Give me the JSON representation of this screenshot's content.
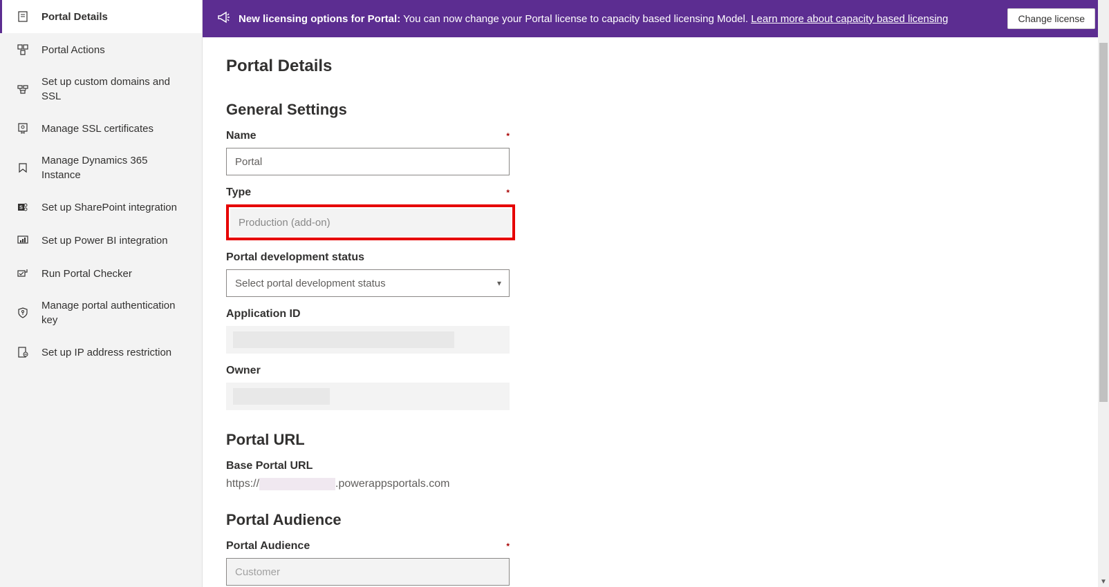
{
  "sidebar": {
    "items": [
      {
        "label": "Portal Details",
        "active": true,
        "icon": "document-icon"
      },
      {
        "label": "Portal Actions",
        "active": false,
        "icon": "actions-icon"
      },
      {
        "label": "Set up custom domains and SSL",
        "active": false,
        "icon": "domains-icon"
      },
      {
        "label": "Manage SSL certificates",
        "active": false,
        "icon": "certificate-icon"
      },
      {
        "label": "Manage Dynamics 365 Instance",
        "active": false,
        "icon": "dynamics-icon"
      },
      {
        "label": "Set up SharePoint integration",
        "active": false,
        "icon": "sharepoint-icon"
      },
      {
        "label": "Set up Power BI integration",
        "active": false,
        "icon": "powerbi-icon"
      },
      {
        "label": "Run Portal Checker",
        "active": false,
        "icon": "checker-icon"
      },
      {
        "label": "Manage portal authentication key",
        "active": false,
        "icon": "key-icon"
      },
      {
        "label": "Set up IP address restriction",
        "active": false,
        "icon": "ip-icon"
      }
    ]
  },
  "banner": {
    "title": "New licensing options for Portal:",
    "text": "You can now change your Portal license to capacity based licensing Model.",
    "link": "Learn more about capacity based licensing",
    "button": "Change license"
  },
  "page": {
    "title": "Portal Details",
    "general_title": "General Settings",
    "name_label": "Name",
    "name_value": "Portal",
    "type_label": "Type",
    "type_value": "Production (add-on)",
    "status_label": "Portal development status",
    "status_placeholder": "Select portal development status",
    "appid_label": "Application ID",
    "owner_label": "Owner",
    "url_title": "Portal URL",
    "baseurl_label": "Base Portal URL",
    "url_prefix": "https://",
    "url_domain": ".powerappsportals.com",
    "audience_title": "Portal Audience",
    "audience_label": "Portal Audience",
    "audience_value": "Customer"
  }
}
